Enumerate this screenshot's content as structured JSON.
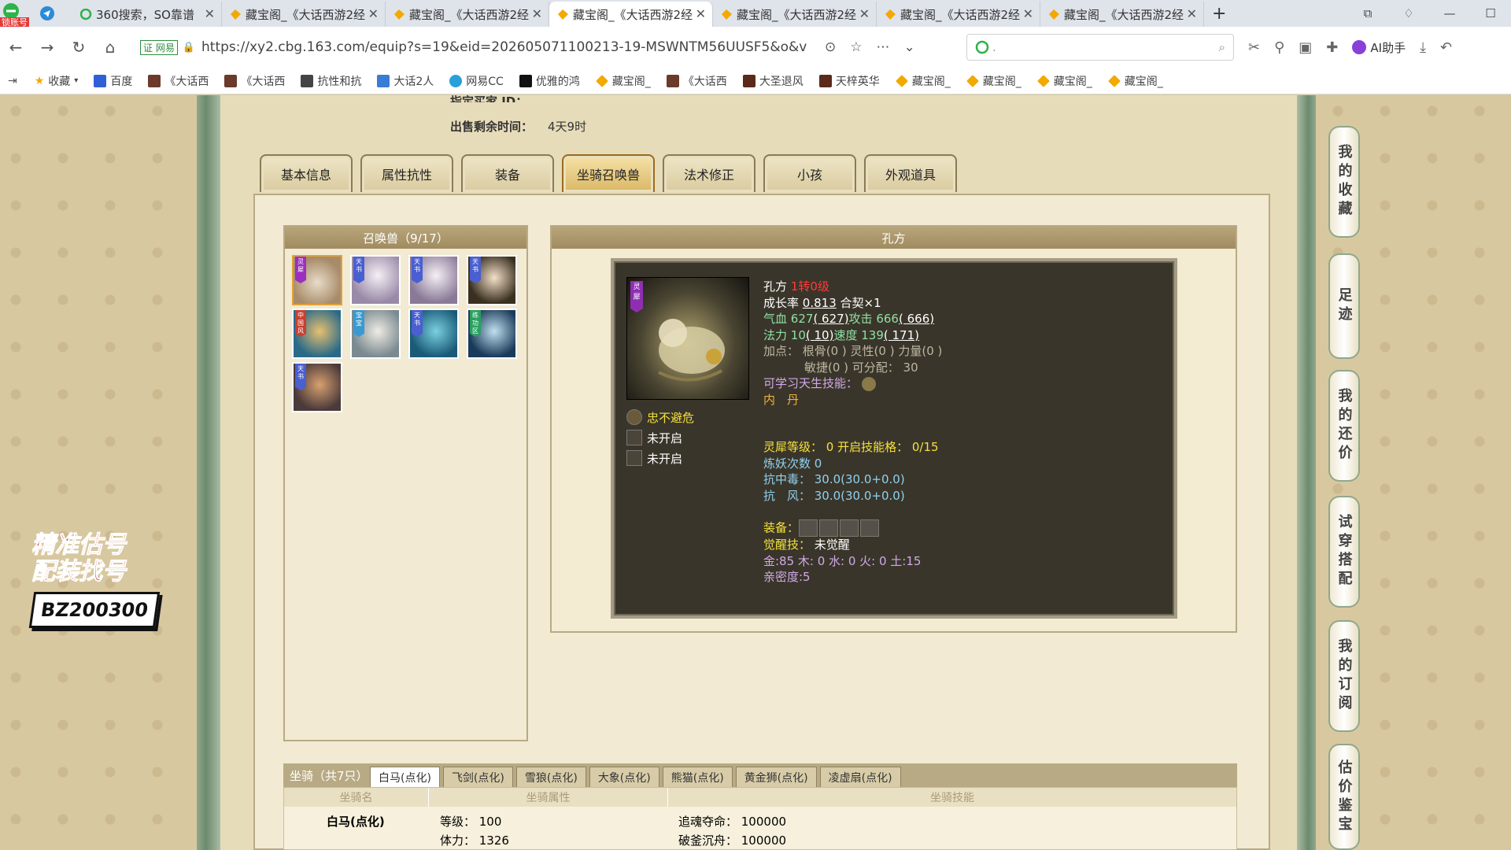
{
  "browser": {
    "badge": "锁账号",
    "tabs": [
      {
        "label": "360搜索，SO靠谱",
        "active": false
      },
      {
        "label": "藏宝阁_《大话西游2经",
        "active": false
      },
      {
        "label": "藏宝阁_《大话西游2经",
        "active": false
      },
      {
        "label": "藏宝阁_《大话西游2经",
        "active": true
      },
      {
        "label": "藏宝阁_《大话西游2经",
        "active": false
      },
      {
        "label": "藏宝阁_《大话西游2经",
        "active": false
      },
      {
        "label": "藏宝阁_《大话西游2经",
        "active": false
      }
    ],
    "secure_label": "证 网易",
    "url": "https://xy2.cbg.163.com/equip?s=19&eid=202605071100213-19-MSWNTM56UUSF5&o&view",
    "search_placeholder": ".",
    "ai_label": "AI助手",
    "bookmarks": [
      "收藏",
      "百度",
      "《大话西",
      "《大话西",
      "抗性和抗",
      "大话2人",
      "网易CC",
      "优雅的鸿",
      "藏宝阁_",
      "《大话西",
      "大圣退风",
      "天梓英华",
      "藏宝阁_",
      "藏宝阁_",
      "藏宝阁_",
      "藏宝阁_"
    ]
  },
  "page": {
    "cut_label": "指定买家 ID：",
    "time_label": "出售剩余时间：",
    "time_value": "4天9时",
    "tabs": [
      "基本信息",
      "属性抗性",
      "装备",
      "坐骑召唤兽",
      "法术修正",
      "小孩",
      "外观道具"
    ],
    "active_tab": "坐骑召唤兽",
    "pets_header": "召唤兽（9/17）",
    "pet_tags": [
      "灵犀",
      "天书",
      "天书",
      "天书",
      "中国风",
      "宝宝",
      "天书",
      "练功区",
      "天书"
    ],
    "detail_header": "孔方",
    "pet": {
      "name": "孔方",
      "level": "1转0级",
      "growth_label": "成长率",
      "growth": "0.813",
      "contract": "合契×1",
      "hp_label": "气血",
      "hp": "627",
      "hp_max": "( 627)",
      "atk_label": "攻击",
      "atk": "666",
      "atk_max": "( 666)",
      "mp_label": "法力",
      "mp": "10",
      "mp_max": "( 10)",
      "spd_label": "速度",
      "spd": "139",
      "spd_max": "( 171)",
      "points_line1": "加点：  根骨(0 ) 灵性(0 ) 力量(0 )",
      "points_line2": "敏捷(0 ) 可分配：  30",
      "learnable": "可学习天生技能：",
      "neidan": "内　丹",
      "skills": [
        "忠不避危",
        "未开启",
        "未开启"
      ],
      "lingxi": "灵犀等级：  0 开启技能格：  0/15",
      "lianyao": "炼妖次数 0",
      "kangdu": "抗中毒：  30.0(30.0+0.0)",
      "kangfeng": "抗　风：  30.0(30.0+0.0)",
      "equip_label": "装备：",
      "awaken_label": "觉醒技：",
      "awaken_value": "未觉醒",
      "elements": "金:85 木: 0 水: 0 火: 0 土:15",
      "intimacy": "亲密度:5"
    },
    "mount": {
      "title": "坐骑（共7只）",
      "tabs": [
        "白马(点化)",
        "飞剑(点化)",
        "雪狼(点化)",
        "大象(点化)",
        "熊猫(点化)",
        "黄金狮(点化)",
        "凌虚扇(点化)"
      ],
      "active_tab": "白马(点化)",
      "headers": [
        "坐骑名",
        "坐骑属性",
        "坐骑技能"
      ],
      "name": "白马(点化)",
      "attr1": "等级：  100",
      "attr2": "体力：  1326",
      "skill1": "追魂夺命：  100000",
      "skill2": "破釜沉舟：  100000"
    }
  },
  "promo": {
    "line1": "精准估号",
    "line2": "配装找号",
    "code": "BZ200300"
  },
  "side_buttons": [
    "我的收藏",
    "足迹",
    "我的还价",
    "试穿搭配",
    "我的订阅",
    "估价鉴宝"
  ],
  "colors": {
    "accent_gold": "#e0a23a",
    "panel_bar": "#b9a57a",
    "card_bg": "#3a352a"
  }
}
